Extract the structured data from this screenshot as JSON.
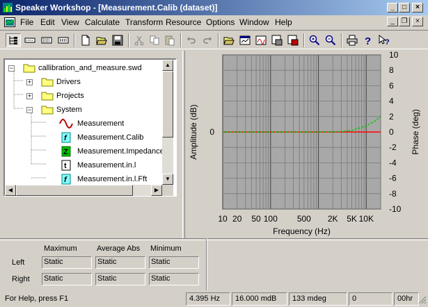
{
  "window": {
    "title": "Speaker Workshop - [Measurement.Calib (dataset)]"
  },
  "menu": [
    {
      "label": "File"
    },
    {
      "label": "Edit"
    },
    {
      "label": "View"
    },
    {
      "label": "Calculate"
    },
    {
      "label": "Transform"
    },
    {
      "label": "Resource"
    },
    {
      "label": "Options"
    },
    {
      "label": "Window"
    },
    {
      "label": "Help"
    }
  ],
  "tree": {
    "root": "callibration_and_measure.swd",
    "folders": [
      "Drivers",
      "Projects",
      "System"
    ],
    "children": [
      "Measurement",
      "Measurement.Calib",
      "Measurement.Impedance",
      "Measurement.in.l",
      "Measurement.in.l.Fft"
    ]
  },
  "chart_data": {
    "type": "line",
    "title": "",
    "xlabel": "Frequency (Hz)",
    "ylabel": "Amplitude (dB)",
    "y2label": "Phase (deg)",
    "x_scale": "log",
    "xlim": [
      10,
      20000
    ],
    "x_tick_labels": [
      "10",
      "20",
      "50",
      "100",
      "500",
      "2K",
      "5K",
      "10K"
    ],
    "x_ticks": [
      10,
      20,
      50,
      100,
      500,
      2000,
      5000,
      10000
    ],
    "y_tick_labels": [
      "0"
    ],
    "y_ticks": [
      0
    ],
    "ylim": [
      -1,
      1
    ],
    "y2lim": [
      -10,
      10
    ],
    "y2_tick_labels": [
      "10",
      "8",
      "6",
      "4",
      "2",
      "0",
      "-2",
      "-4",
      "-6",
      "-8",
      "-10"
    ],
    "grid": true,
    "series": [
      {
        "axis": "left",
        "color": "#ff0000",
        "style": "solid",
        "x": [
          10,
          100,
          1000,
          5000,
          10000,
          20000
        ],
        "y": [
          0,
          0,
          0,
          0,
          0,
          0
        ]
      },
      {
        "axis": "right",
        "color": "#00cc00",
        "style": "dashed",
        "x": [
          10,
          100,
          1000,
          3000,
          5000,
          10000,
          15000,
          20000
        ],
        "y": [
          0,
          0,
          0,
          0.05,
          0.2,
          0.8,
          1.4,
          2.0
        ]
      }
    ]
  },
  "stats": {
    "headers": [
      "Maximum",
      "Average Abs",
      "Minimum"
    ],
    "rows": [
      {
        "label": "Left",
        "values": [
          "Static",
          "Static",
          "Static"
        ]
      },
      {
        "label": "Right",
        "values": [
          "Static",
          "Static",
          "Static"
        ]
      }
    ]
  },
  "status": {
    "help": "For Help, press F1",
    "freq": "4.395 Hz",
    "mdb": "16.000 mdB",
    "mdeg": "133 mdeg",
    "zero": "0",
    "hr": "00hr"
  }
}
